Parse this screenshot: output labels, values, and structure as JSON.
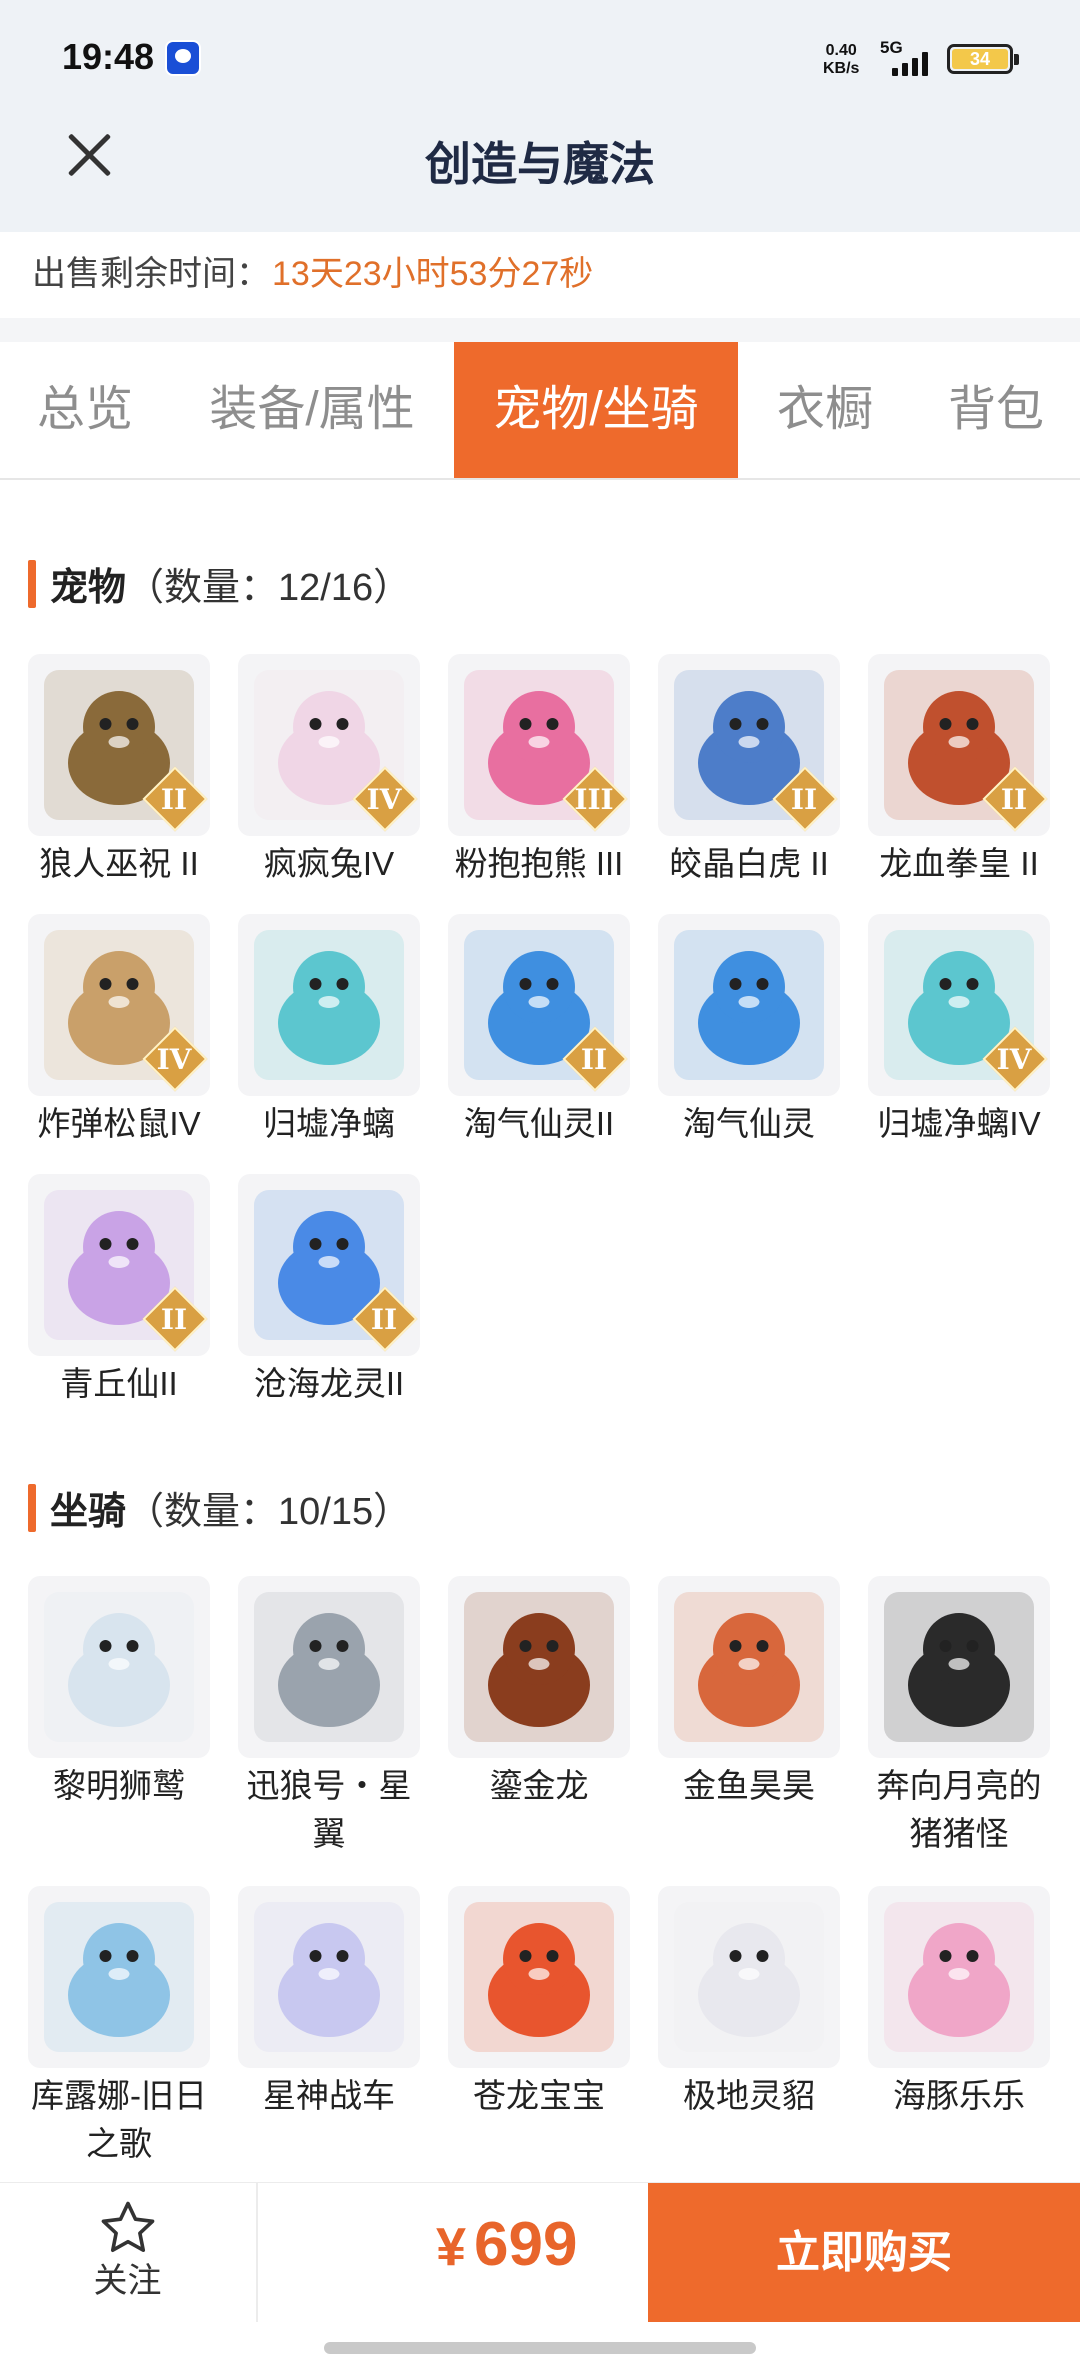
{
  "status_bar": {
    "time": "19:48",
    "speed_value": "0.40",
    "speed_unit": "KB/s",
    "network": "5G",
    "battery": "34"
  },
  "header": {
    "title": "创造与魔法",
    "close_icon": "close-icon"
  },
  "sale": {
    "label": "出售剩余时间：",
    "remaining": "13天23小时53分27秒"
  },
  "tabs": [
    {
      "label": "总览",
      "active": false
    },
    {
      "label": "装备/属性",
      "active": false
    },
    {
      "label": "宠物/坐骑",
      "active": true
    },
    {
      "label": "衣橱",
      "active": false
    },
    {
      "label": "背包",
      "active": false
    }
  ],
  "pets": {
    "name": "宠物",
    "count": "（数量：12/16）",
    "items": [
      {
        "name": "狼人巫祝 II",
        "grade": "II",
        "color": "#8a6a3a"
      },
      {
        "name": "疯疯兔IV",
        "grade": "IV",
        "color": "#f0d6e6"
      },
      {
        "name": "粉抱抱熊 III",
        "grade": "III",
        "color": "#e86fa0"
      },
      {
        "name": "皎晶白虎 II",
        "grade": "II",
        "color": "#4d7dc9"
      },
      {
        "name": "龙血拳皇 II",
        "grade": "II",
        "color": "#c0502e"
      },
      {
        "name": "炸弹松鼠IV",
        "grade": "IV",
        "color": "#c9a06a"
      },
      {
        "name": "归墟净螭",
        "grade": "",
        "color": "#5cc6cf"
      },
      {
        "name": "淘气仙灵II",
        "grade": "II",
        "color": "#3f8fe0"
      },
      {
        "name": "淘气仙灵",
        "grade": "",
        "color": "#3f8fe0"
      },
      {
        "name": "归墟净螭IV",
        "grade": "IV",
        "color": "#5cc6cf"
      },
      {
        "name": "青丘仙II",
        "grade": "II",
        "color": "#c9a3e6"
      },
      {
        "name": "沧海龙灵II",
        "grade": "II",
        "color": "#4a8ae6"
      }
    ]
  },
  "mounts": {
    "name": "坐骑",
    "count": "（数量：10/15）",
    "items": [
      {
        "name": "黎明狮鹫",
        "color": "#d8e4ee"
      },
      {
        "name": "迅狼号・星翼",
        "color": "#9aa3ad"
      },
      {
        "name": "鎏金龙",
        "color": "#8a3d1e"
      },
      {
        "name": "金鱼昊昊",
        "color": "#d8673c"
      },
      {
        "name": "奔向月亮的猪猪怪",
        "color": "#2a2a2a"
      },
      {
        "name": "库露娜-旧日之歌",
        "color": "#8fc4e6"
      },
      {
        "name": "星神战车",
        "color": "#c8c8f0"
      },
      {
        "name": "苍龙宝宝",
        "color": "#e8552e"
      },
      {
        "name": "极地灵貂",
        "color": "#e8e8ee"
      },
      {
        "name": "海豚乐乐",
        "color": "#f0a6c8"
      }
    ]
  },
  "bottom": {
    "follow_label": "关注",
    "currency": "¥",
    "price": "699",
    "buy_label": "立即购买",
    "accent": "#ee6a2c"
  }
}
